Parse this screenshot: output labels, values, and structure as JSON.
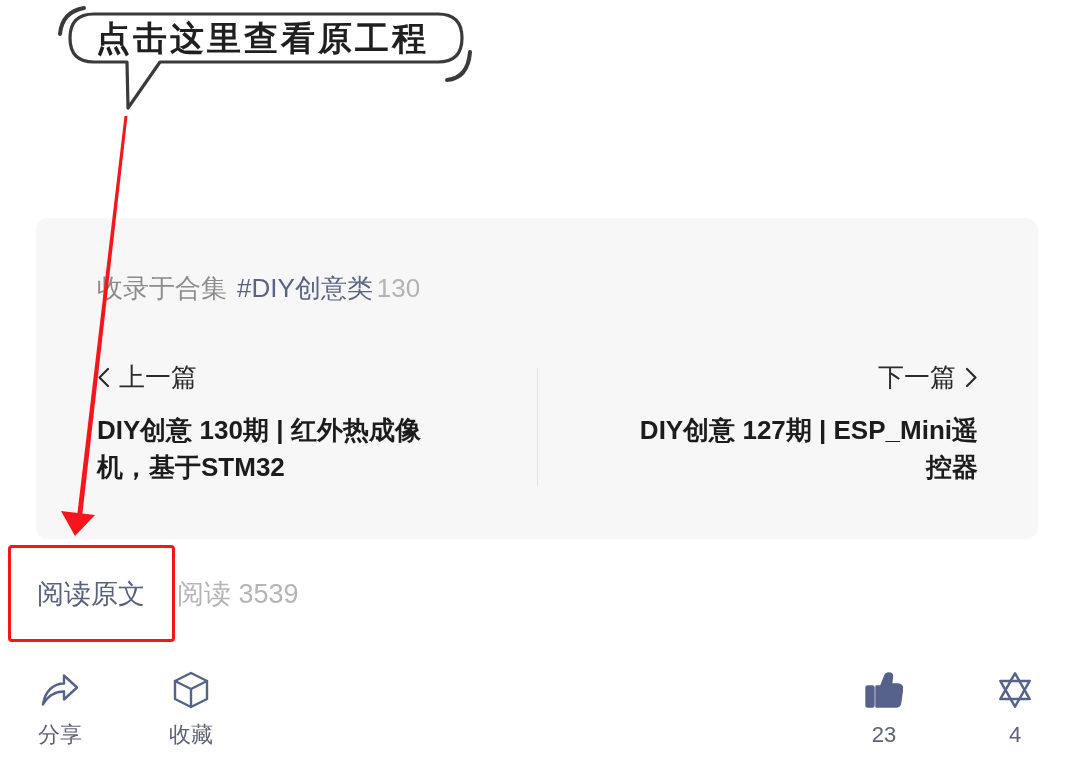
{
  "annotation": {
    "callout_text": "点击这里查看原工程"
  },
  "collection_card": {
    "collection": {
      "prefix": "收录于合集",
      "tag": "#DIY创意类",
      "count": "130"
    },
    "previous": {
      "label": "上一篇",
      "title": "DIY创意 130期 | 红外热成像机，基于STM32"
    },
    "next": {
      "label": "下一篇",
      "title": "DIY创意 127期 | ESP_Mini遥控器"
    }
  },
  "read_original": {
    "link": "阅读原文",
    "views": "阅读 3539"
  },
  "toolbar": {
    "left": [
      {
        "kind": "share",
        "label": "分享",
        "active": false
      },
      {
        "kind": "favorite",
        "label": "收藏",
        "active": false
      }
    ],
    "right": [
      {
        "kind": "like",
        "label": "23",
        "active": true
      },
      {
        "kind": "wow",
        "label": "4",
        "active": false
      }
    ]
  }
}
